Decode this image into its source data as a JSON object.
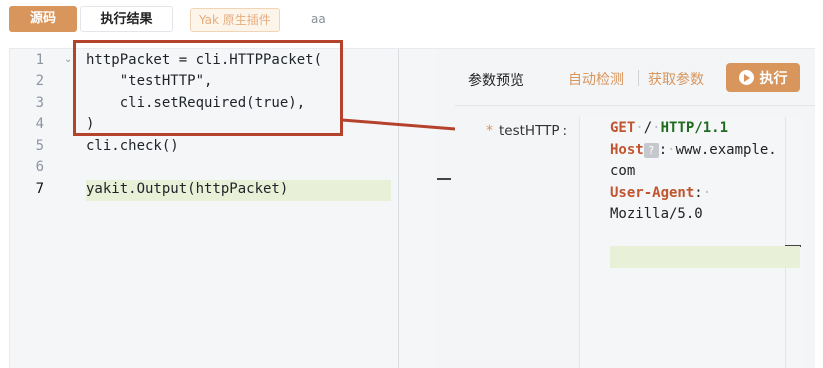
{
  "tabs": {
    "source": "源码",
    "result": "执行结果"
  },
  "tags": {
    "yak_native": "Yak 原生插件",
    "aa": "aa"
  },
  "editor": {
    "line_numbers": [
      "1",
      "2",
      "3",
      "4",
      "5",
      "6",
      "7"
    ],
    "lines": [
      "httpPacket = cli.HTTPPacket(",
      "    \"testHTTP\",",
      "    cli.setRequired(true),",
      ")",
      "cli.check()",
      "",
      "yakit.Output(httpPacket)"
    ]
  },
  "panel": {
    "title": "参数预览",
    "auto_detect": "自动检测",
    "get_params": "获取参数",
    "run": "执行"
  },
  "field": {
    "required_mark": "*",
    "label": "testHTTP",
    "colon": ":"
  },
  "request": {
    "method": "GET",
    "path": "/",
    "version": "HTTP/1.1",
    "host_key": "Host",
    "host_hint": "?",
    "host_value_1": "www.example.",
    "host_value_2": "com",
    "ua_key": "User-Agent",
    "ua_value": "Mozilla/5.0"
  },
  "colors": {
    "accent": "#d8955c",
    "annotation": "#b5422c"
  }
}
